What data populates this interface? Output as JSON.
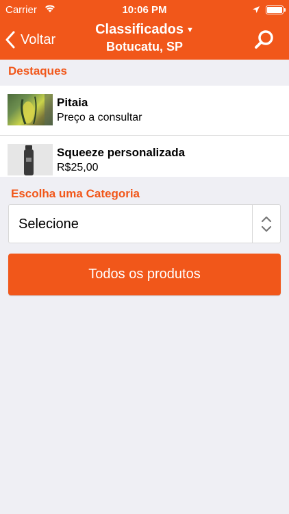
{
  "status_bar": {
    "carrier": "Carrier",
    "time": "10:06 PM"
  },
  "navbar": {
    "back_label": "Voltar",
    "title": "Classificados",
    "subtitle": "Botucatu, SP",
    "accent_color": "#f1571a"
  },
  "highlights": {
    "heading": "Destaques",
    "items": [
      {
        "name": "Pitaia",
        "price": "Preço a consultar"
      },
      {
        "name": "Squeeze personalizada",
        "price": "R$25,00"
      }
    ]
  },
  "category": {
    "heading": "Escolha uma Categoria",
    "selected": "Selecione"
  },
  "all_products_button": "Todos os produtos"
}
